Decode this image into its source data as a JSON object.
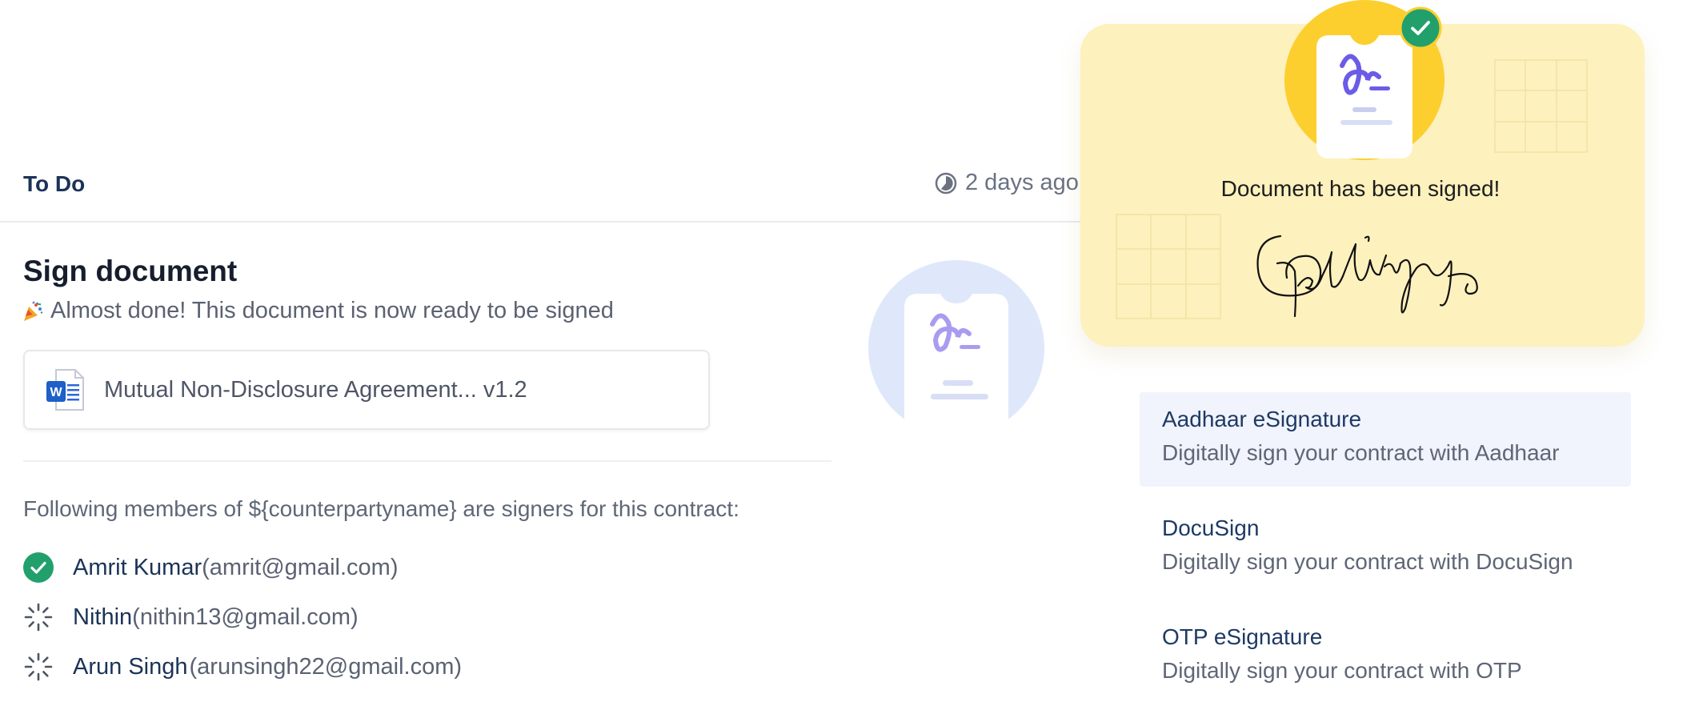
{
  "task": {
    "status_label": "To Do",
    "time_label": "2 days ago",
    "title": "Sign document",
    "subtitle": "Almost done! This document is now ready to be signed",
    "document_name": "Mutual Non-Disclosure Agreement... v1.2",
    "members_intro": "Following members of ${counterpartyname} are signers for this contract:",
    "signers": [
      {
        "name": "Amrit Kumar",
        "email": " (amrit@gmail.com)",
        "status": "signed"
      },
      {
        "name": "Nithin",
        "email": " (nithin13@gmail.com)",
        "status": "pending"
      },
      {
        "name": "Arun Singh",
        "email": "(arunsingh22@gmail.com)",
        "status": "pending"
      }
    ]
  },
  "signed_popup": {
    "message": "Document has been signed!"
  },
  "sign_options": [
    {
      "title": "Aadhaar eSignature",
      "description": "Digitally sign your contract with Aadhaar",
      "active": true
    },
    {
      "title": "DocuSign",
      "description": "Digitally sign your contract with DocuSign",
      "active": false
    },
    {
      "title": "OTP eSignature",
      "description": "Digitally sign your contract with OTP",
      "active": false
    }
  ],
  "colors": {
    "success": "#22a06b",
    "accent_purple": "#6b5ce7",
    "popup_bg": "#fdf1bd",
    "popup_circle": "#fccf2e",
    "illustration_circle": "#dfe8fb"
  },
  "icons": {
    "time": "clock-icon",
    "party": "party-popper-icon",
    "word": "word-file-icon",
    "signed": "check-circle-icon",
    "pending": "spinner-icon",
    "document": "signature-document-icon"
  }
}
